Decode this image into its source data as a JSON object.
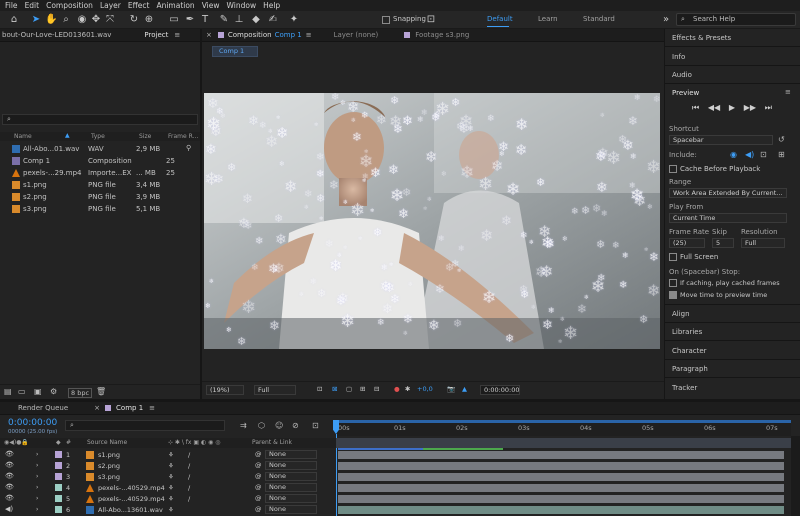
{
  "menu": [
    "File",
    "Edit",
    "Composition",
    "Layer",
    "Effect",
    "Animation",
    "View",
    "Window",
    "Help"
  ],
  "toolbar": {
    "snapping_label": "Snapping",
    "workspaces": [
      "Default",
      "Learn",
      "Standard"
    ],
    "active_workspace": "Default",
    "search_help": "Search Help"
  },
  "project": {
    "header_file": "bout-Our-Love-LED013601.wav",
    "tab_label": "Project",
    "search_placeholder": "",
    "columns": [
      "Name",
      "Type",
      "Size",
      "Frame R..."
    ],
    "items": [
      {
        "name": "All-Abo...01.wav",
        "type": "WAV",
        "size": "2,9 MB",
        "frame": "",
        "kind": "wav"
      },
      {
        "name": "Comp 1",
        "type": "Composition",
        "size": "",
        "frame": "25",
        "kind": "comp"
      },
      {
        "name": "pexels-...29.mp4",
        "type": "Importe...EX",
        "size": "... MB",
        "frame": "25",
        "kind": "mp4"
      },
      {
        "name": "s1.png",
        "type": "PNG file",
        "size": "3,4 MB",
        "frame": "",
        "kind": "png"
      },
      {
        "name": "s2.png",
        "type": "PNG file",
        "size": "3,9 MB",
        "frame": "",
        "kind": "png"
      },
      {
        "name": "s3.png",
        "type": "PNG file",
        "size": "5,1 MB",
        "frame": "",
        "kind": "png"
      }
    ],
    "bpc": "8 bpc"
  },
  "viewer": {
    "tab_composition": "Composition",
    "tab_comp_name": "Comp 1",
    "tab_layer": "Layer (none)",
    "tab_footage": "Footage s3.png",
    "comp_subtab": "Comp 1",
    "zoom": "(19%)",
    "quality": "Full",
    "exposure": "+0,0",
    "timecode": "0:00:00:00"
  },
  "right_panel": {
    "effects_presets": "Effects & Presets",
    "info": "Info",
    "audio": "Audio",
    "preview": "Preview",
    "shortcut_label": "Shortcut",
    "shortcut_value": "Spacebar",
    "include_label": "Include:",
    "cache_before_playback": "Cache Before Playback",
    "range_label": "Range",
    "range_value": "Work Area Extended By Current...",
    "play_from_label": "Play From",
    "play_from_value": "Current Time",
    "frame_rate_label": "Frame Rate",
    "skip_label": "Skip",
    "resolution_label": "Resolution",
    "frame_rate_value": "(25)",
    "skip_value": "5",
    "resolution_value": "Full",
    "full_screen": "Full Screen",
    "on_stop_label": "On (Spacebar) Stop:",
    "if_caching": "If caching, play cached frames",
    "move_time": "Move time to preview time",
    "align": "Align",
    "libraries": "Libraries",
    "character": "Character",
    "paragraph": "Paragraph",
    "tracker": "Tracker"
  },
  "timeline": {
    "render_queue": "Render Queue",
    "comp_tab": "Comp 1",
    "current_time": "0:00:00:00",
    "fps_info": "00000 (25.00 fps)",
    "search_placeholder": "",
    "col_source_name": "Source Name",
    "col_parent": "Parent & Link",
    "ruler": [
      "00s",
      "01s",
      "02s",
      "03s",
      "04s",
      "05s",
      "06s",
      "07s"
    ],
    "layers": [
      {
        "num": "1",
        "name": "s1.png",
        "parent": "None",
        "kind": "png",
        "label_color": "#b7a3d6"
      },
      {
        "num": "2",
        "name": "s2.png",
        "parent": "None",
        "kind": "png",
        "label_color": "#b7a3d6"
      },
      {
        "num": "3",
        "name": "s3.png",
        "parent": "None",
        "kind": "png",
        "label_color": "#b7a3d6"
      },
      {
        "num": "4",
        "name": "pexels-...40529.mp4",
        "parent": "None",
        "kind": "mp4",
        "label_color": "#9ccfc4"
      },
      {
        "num": "5",
        "name": "pexels-...40529.mp4",
        "parent": "None",
        "kind": "mp4",
        "label_color": "#9ccfc4"
      },
      {
        "num": "6",
        "name": "All-Abo...13601.wav",
        "parent": "None",
        "kind": "wav",
        "label_color": "#9ccfc4"
      }
    ]
  },
  "colors": {
    "accent": "#3d9df5",
    "panel_bg": "#232323",
    "layer_bar": "#777a80"
  }
}
